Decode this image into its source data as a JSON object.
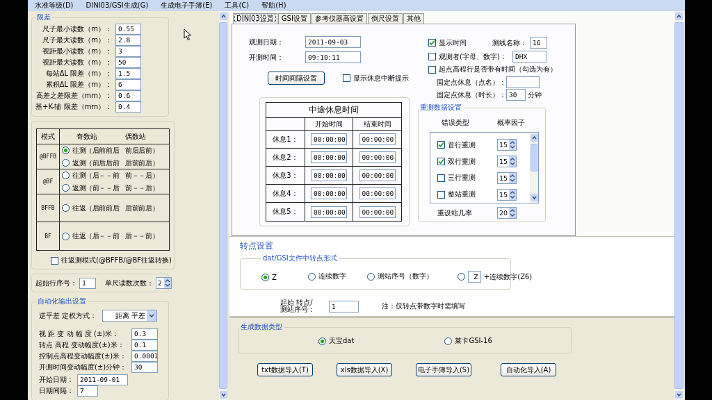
{
  "menu": [
    {
      "label": "水准等级(D)"
    },
    {
      "label": "DINI03/GSI生成(G)"
    },
    {
      "label": "生成电子手簿(E)"
    },
    {
      "label": "工具(C)"
    },
    {
      "label": "帮助(H)"
    }
  ],
  "limits": {
    "title": "限差",
    "rows": [
      {
        "label": "尺子最小读数（m）：",
        "value": "0.55"
      },
      {
        "label": "尺子最大读数（m）：",
        "value": "2.8"
      },
      {
        "label": "视距最小读数（m）：",
        "value": "3"
      },
      {
        "label": "视距最大读数（m）：",
        "value": "50"
      },
      {
        "label": "每站ΔL 限差（m）：",
        "value": "1.5"
      },
      {
        "label": "累积ΔL 限差（m）：",
        "value": "6"
      },
      {
        "label": "高差之差限差（mm）：",
        "value": "0.6"
      },
      {
        "label": "基+K-辅 限差（mm）：",
        "value": "0.4"
      }
    ]
  },
  "mode_table": {
    "header_mode": "模式",
    "header_odd": "奇数站",
    "header_even": "偶数站",
    "rows": [
      {
        "mode": "@BFFB",
        "options": [
          {
            "label": "往测（后前前后",
            "even": "前后后前）",
            "selected": true
          },
          {
            "label": "返测（前后后前",
            "even": "后前前后）",
            "selected": false
          }
        ]
      },
      {
        "mode": "@BF",
        "options": [
          {
            "label": "往测（后－－前",
            "even": "前－－后）",
            "selected": false
          },
          {
            "label": "返测（前－－后",
            "even": "前－－后）",
            "selected": false
          }
        ]
      },
      {
        "mode": "BFFB",
        "options": [
          {
            "label": "往返（后前前后",
            "even": "后前前后）",
            "selected": false
          }
        ]
      },
      {
        "mode": "BF",
        "options": [
          {
            "label": "往返（后－－前",
            "even": "后－－前）",
            "selected": false
          }
        ]
      }
    ],
    "round_trip": {
      "label": "往返测模式(@BFFB/@BF往返转换)",
      "checked": false
    }
  },
  "start_row": {
    "label": "起始行序号：",
    "value": "1"
  },
  "reads": {
    "label": "单尺读数次数：",
    "value": "2"
  },
  "automation": {
    "title": "自动化输出设置",
    "weighting": {
      "label": "逆平差 定权方式：",
      "value": "距离 平差"
    },
    "fields": [
      {
        "label": "视 距 变 动 幅 度 (±)米：",
        "value": "0.3"
      },
      {
        "label": "转点 高程 变动幅度(±)米：",
        "value": "0.1"
      },
      {
        "label": "控制点高程变动幅度(±)米：",
        "value": "0.0001"
      },
      {
        "label": "开测时间变动幅度(±)分钟：",
        "value": "30"
      }
    ],
    "start_date": {
      "label": "开始日期：",
      "value": "2011-09-01"
    },
    "interval": {
      "label": "日期间隔：",
      "value": "7"
    }
  },
  "tabs": [
    {
      "label": "DINI03设置",
      "selected": true
    },
    {
      "label": "GSI设置",
      "selected": false
    },
    {
      "label": "参考仪器高设置",
      "selected": false
    },
    {
      "label": "倒尺设置",
      "selected": false
    },
    {
      "label": "其他",
      "selected": false
    }
  ],
  "dini": {
    "obs_date": {
      "label": "观测日期：",
      "value": "2011-09-03"
    },
    "start_time": {
      "label": "开测时间：",
      "value": "09:10:11"
    },
    "interval_button": "时间间隔设置",
    "rest_prompt": {
      "label": "显示休息中断提示",
      "checked": false
    },
    "show_time": {
      "label": "显示时间",
      "checked": true
    },
    "line_name": {
      "label": "测线名称：",
      "value": "16"
    },
    "observer": {
      "label": "观测者(字母、数字)：",
      "checked": false,
      "value": "DHX"
    },
    "start_has_time": {
      "label": "起点高程行是否带有时间（勾选为有）",
      "checked": false
    },
    "fixed_name": {
      "label": "固定点休息（点名）："
    },
    "fixed_duration": {
      "label": "固定点休息（时长）：",
      "value": "30",
      "unit": "分钟"
    },
    "rest_table": {
      "title": "中途休息时间",
      "columns": [
        "开始时间",
        "结束时间"
      ],
      "rows": [
        {
          "label": "休息1：",
          "start": "00:00:00",
          "end": "00:00:00"
        },
        {
          "label": "休息2：",
          "start": "00:00:00",
          "end": "00:00:00"
        },
        {
          "label": "休息3：",
          "start": "00:00:00",
          "end": "00:00:00"
        },
        {
          "label": "休息4：",
          "start": "00:00:00",
          "end": "00:00:00"
        },
        {
          "label": "休息5：",
          "start": "00:00:00",
          "end": "00:00:00"
        }
      ]
    },
    "retest": {
      "title": "重测数据设置",
      "headers": [
        "错误类型",
        "概率因子"
      ],
      "items": [
        {
          "label": "首行重测",
          "checked": true,
          "value": "15"
        },
        {
          "label": "双行重测",
          "checked": true,
          "value": "15"
        },
        {
          "label": "三行重测",
          "checked": false,
          "value": "15"
        },
        {
          "label": "整站重测",
          "checked": false,
          "value": "15"
        }
      ],
      "reset": {
        "label": "重设站几率",
        "value": "20"
      }
    }
  },
  "transfer": {
    "title": "转点设置",
    "group_title": "dat/GSI文件中转点形式",
    "options": [
      {
        "kind": "plain",
        "label": "Z",
        "selected": true
      },
      {
        "kind": "plain",
        "label": "连续数字",
        "selected": false
      },
      {
        "kind": "plain",
        "label": "测站序号（数字）",
        "selected": false
      },
      {
        "kind": "prefix",
        "prefix": "Z",
        "label": "+连续数字(Z6)",
        "selected": false
      }
    ],
    "start_label": [
      "起始 转点/",
      "测站序号："
    ],
    "start_value": "1",
    "note": "注：仅转点带数字时需填写"
  },
  "output": {
    "title": "生成数据类型",
    "options": [
      {
        "label": "天宝dat",
        "selected": true
      },
      {
        "label": "莱卡GSI-16",
        "selected": false
      }
    ],
    "buttons": [
      "txt数据导入(T)",
      "xls数据导入(X)",
      "电子手簿导入(S)",
      "自动化导入(A)"
    ]
  }
}
